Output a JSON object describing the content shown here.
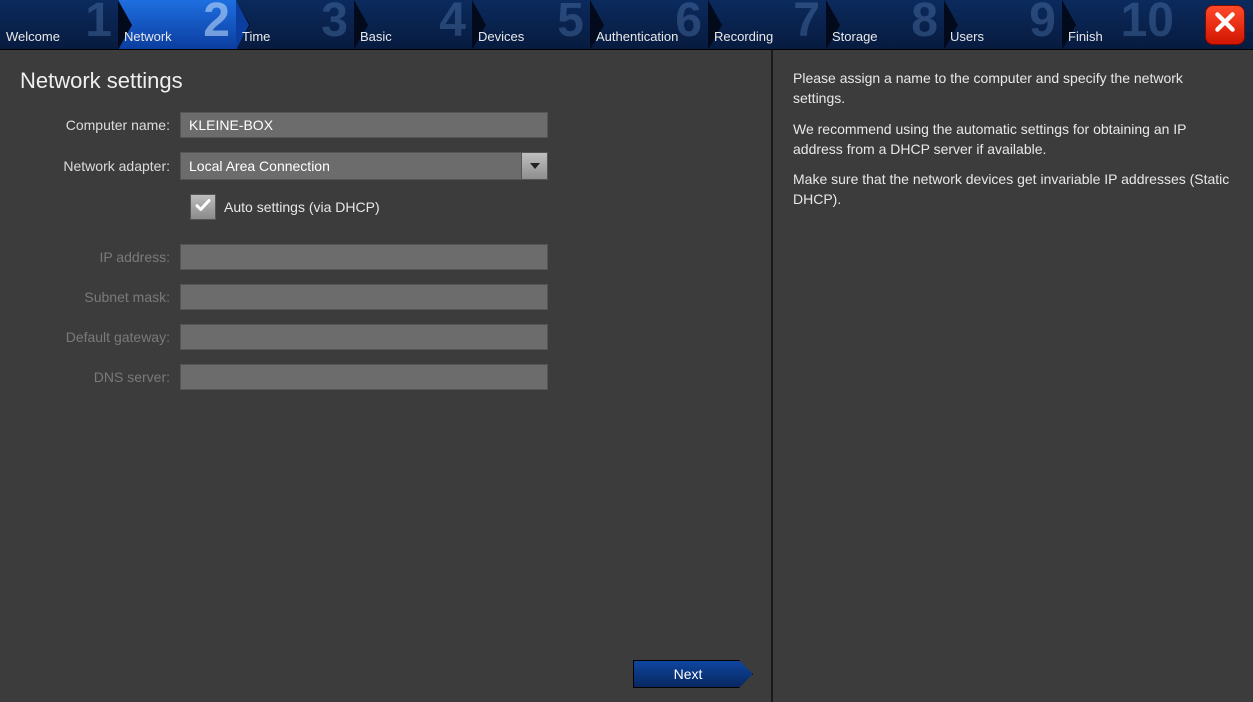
{
  "steps": [
    {
      "num": "1",
      "label": "Welcome"
    },
    {
      "num": "2",
      "label": "Network"
    },
    {
      "num": "3",
      "label": "Time"
    },
    {
      "num": "4",
      "label": "Basic"
    },
    {
      "num": "5",
      "label": "Devices"
    },
    {
      "num": "6",
      "label": "Authentication"
    },
    {
      "num": "7",
      "label": "Recording"
    },
    {
      "num": "8",
      "label": "Storage"
    },
    {
      "num": "9",
      "label": "Users"
    },
    {
      "num": "10",
      "label": "Finish"
    }
  ],
  "active_step_index": 1,
  "page_title": "Network settings",
  "form": {
    "computer_name_label": "Computer name:",
    "computer_name_value": "KLEINE-BOX",
    "adapter_label": "Network adapter:",
    "adapter_value": "Local Area Connection",
    "auto_label": "Auto settings (via DHCP)",
    "auto_checked": true,
    "ip_label": "IP address:",
    "ip_value": "",
    "subnet_label": "Subnet mask:",
    "subnet_value": "",
    "gateway_label": "Default gateway:",
    "gateway_value": "",
    "dns_label": "DNS server:",
    "dns_value": ""
  },
  "next_label": "Next",
  "help": {
    "p1": "Please assign a name to the computer and specify the network settings.",
    "p2": "We recommend using the automatic settings for obtaining an IP address from a DHCP server if available.",
    "p3": "Make sure that the network devices get invariable IP addresses (Static DHCP)."
  }
}
